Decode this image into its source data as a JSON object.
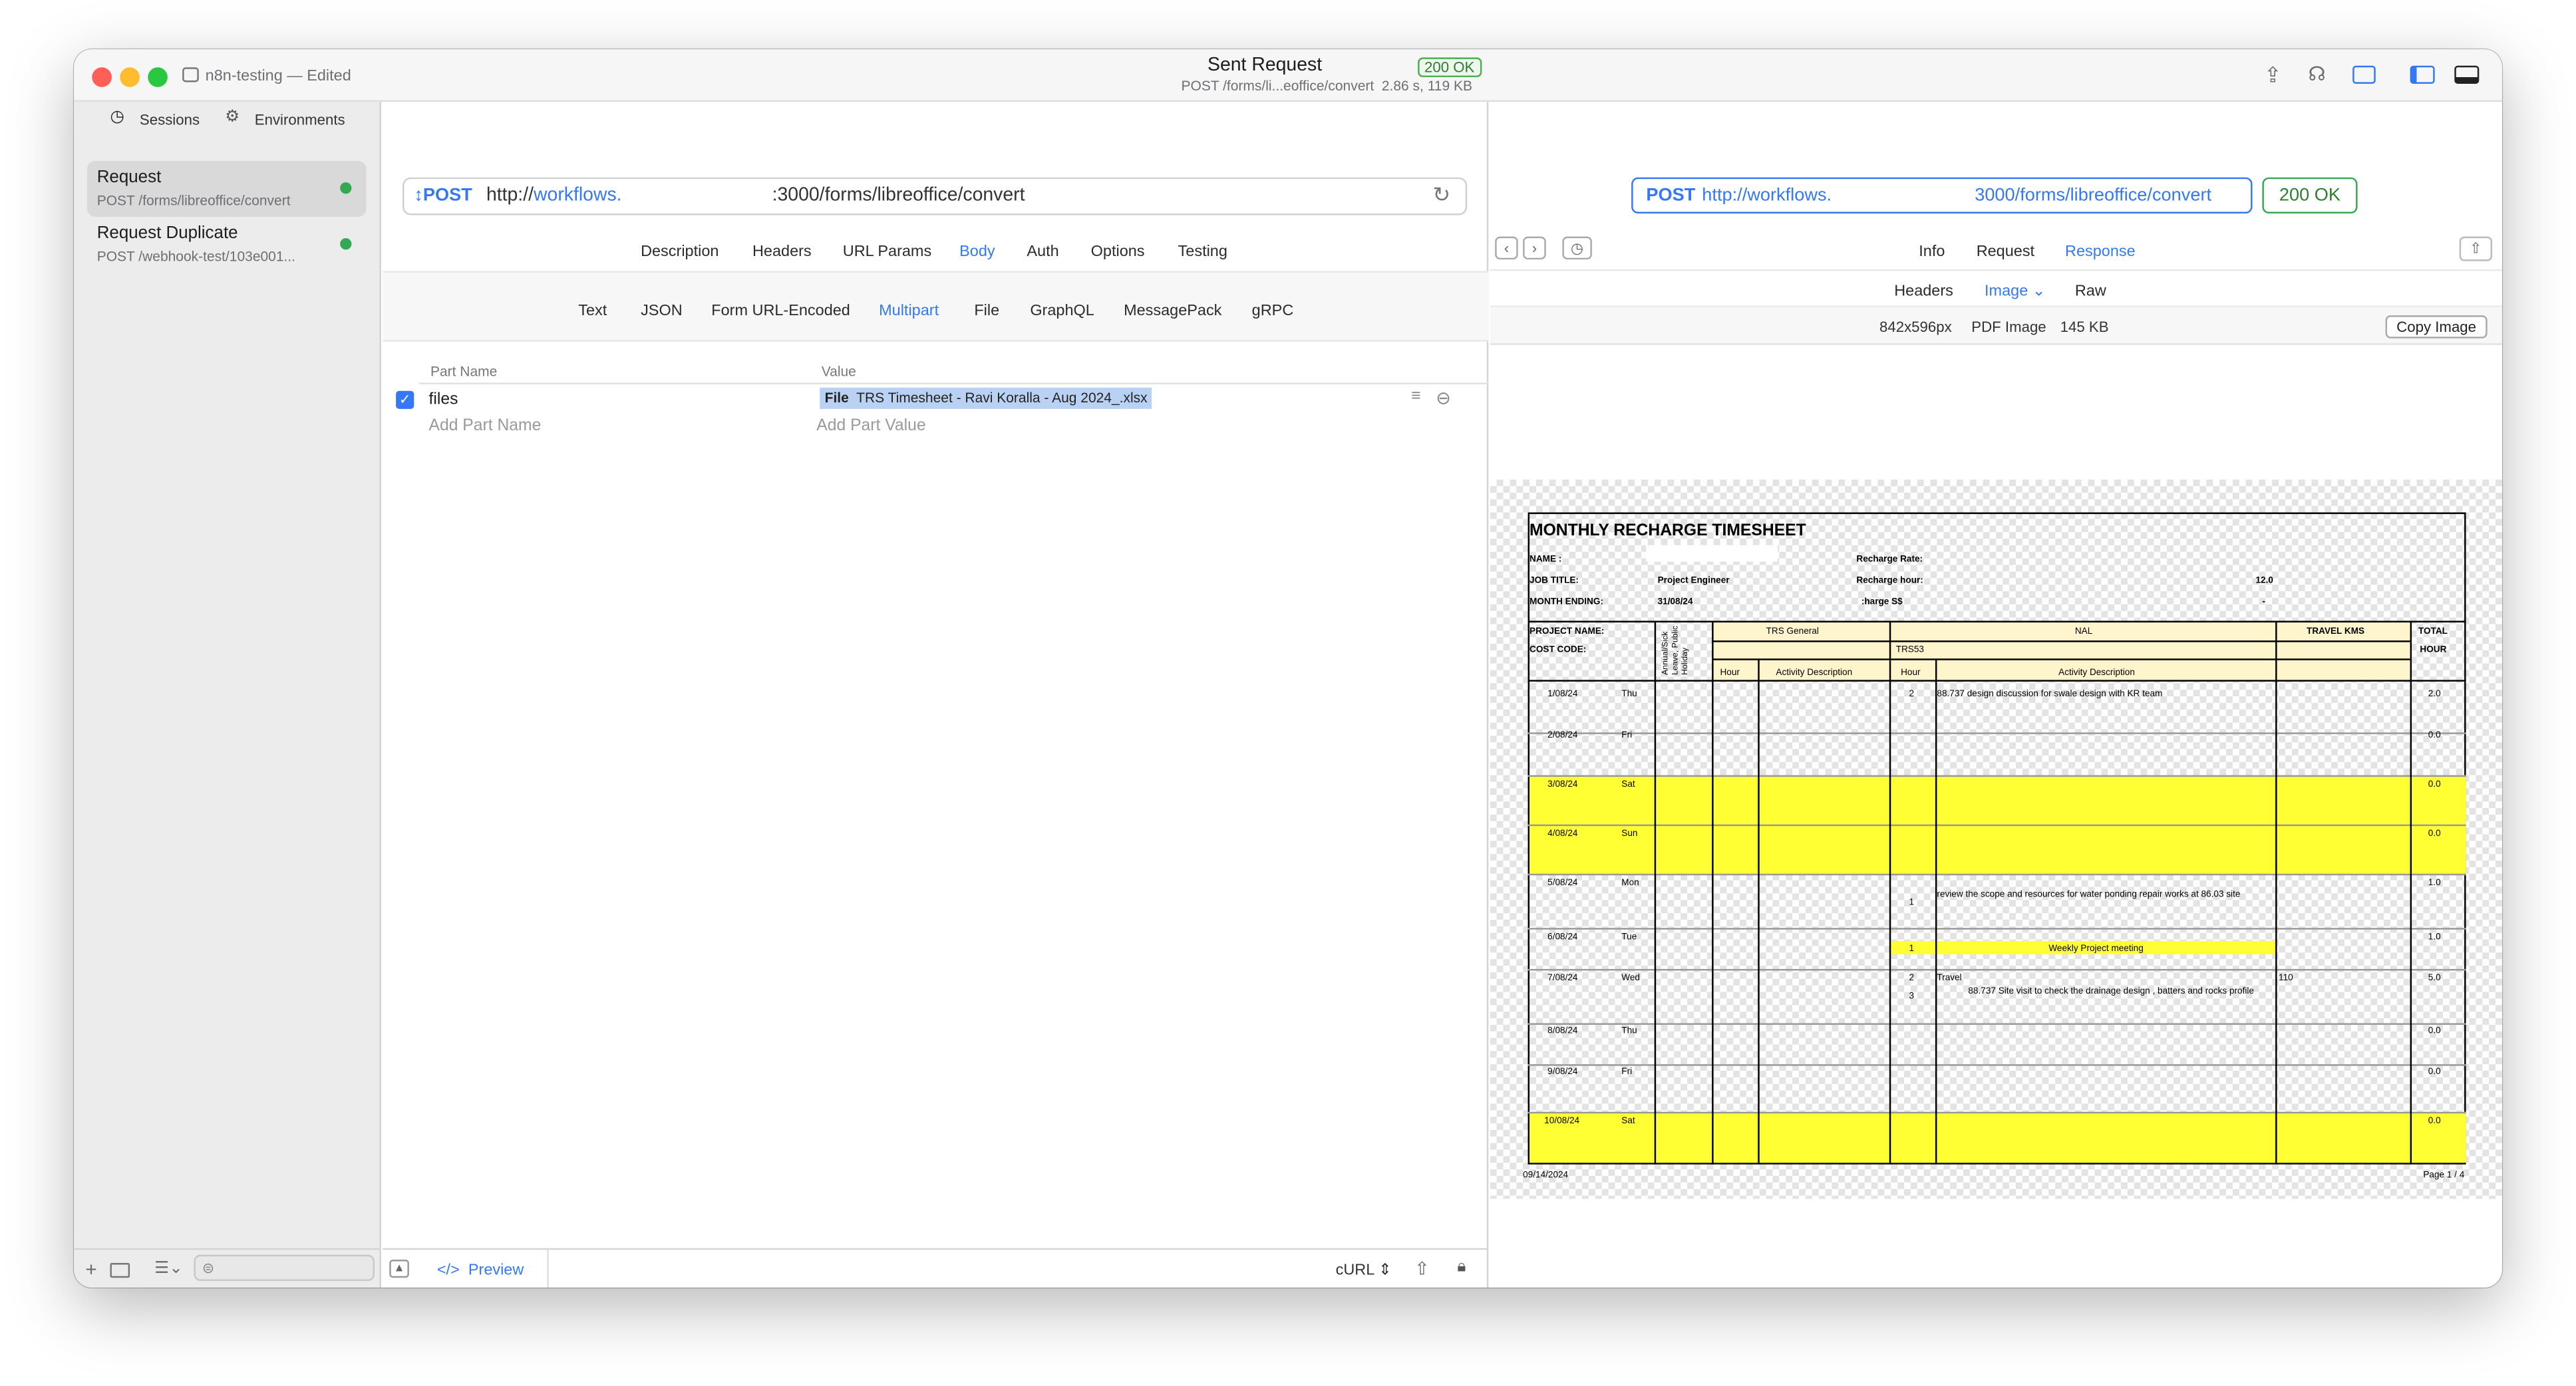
{
  "window": {
    "doc_title": "n8n-testing — Edited",
    "center_title": "Sent Request",
    "status_badge": "200 OK",
    "center_subtitle": "POST /forms/li...eoffice/convert  2.86 s, 119 KB"
  },
  "sidebar": {
    "tabs": [
      "Sessions",
      "Environments"
    ],
    "items": [
      {
        "name": "Request",
        "path": "POST /forms/libreoffice/convert",
        "status_color": "#34a853"
      },
      {
        "name": "Request Duplicate",
        "path": "POST /webhook-test/103e001...",
        "status_color": "#34a853"
      }
    ]
  },
  "request": {
    "method": "POST",
    "url_prefix": "http://",
    "url_host": "workflows.",
    "url_rest": ":3000/forms/libreoffice/convert",
    "tabs": [
      "Description",
      "Headers",
      "URL Params",
      "Body",
      "Auth",
      "Options",
      "Testing"
    ],
    "active_tab": "Body",
    "body_types": [
      "Text",
      "JSON",
      "Form URL-Encoded",
      "Multipart",
      "File",
      "GraphQL",
      "MessagePack",
      "gRPC"
    ],
    "active_body_type": "Multipart",
    "table": {
      "headers": [
        "Part Name",
        "Value"
      ],
      "rows": [
        {
          "name": "files",
          "type": "File",
          "value": "TRS Timesheet - Ravi Koralla - Aug 2024_.xlsx",
          "checked": true
        }
      ],
      "add_name_placeholder": "Add Part Name",
      "add_value_placeholder": "Add Part Value"
    },
    "bottom": {
      "preview": "Preview",
      "format": "cURL"
    }
  },
  "response": {
    "method": "POST",
    "url_prefix": "http://",
    "url_host": "workflows.",
    "url_rest": "3000/forms/libreoffice/convert",
    "status": "200 OK",
    "tabs": [
      "Info",
      "Request",
      "Response"
    ],
    "active_tab": "Response",
    "subtabs": [
      "Headers",
      "Image",
      "Raw"
    ],
    "active_subtab": "Image",
    "image_info": {
      "dimensions": "842x596px",
      "type": "PDF Image",
      "size": "145 KB"
    },
    "copy_button": "Copy Image"
  },
  "timesheet": {
    "title": "MONTHLY RECHARGE TIMESHEET",
    "name_label": "NAME :",
    "job_title_label": "JOB TITLE:",
    "job_title": "Project Engineer",
    "month_ending_label": "MONTH ENDING:",
    "month_ending": "31/08/24",
    "recharge_rate_label": "Recharge Rate:",
    "recharge_hour_label": "Recharge hour:",
    "recharge_hour_value": "12.0",
    "charge_label": ":harge S$",
    "charge_value": "-",
    "project_name_label": "PROJECT NAME:",
    "cost_code_label": "COST CODE:",
    "leave_label": "Annual/Sick Leave, Public Holiday",
    "trs_general": "TRS General",
    "nal": "NAL",
    "travel_kms": "TRAVEL KMS",
    "total": "TOTAL",
    "hour": "HOUR",
    "cost_code": "TRS53",
    "col_hour": "Hour",
    "col_activity": "Activity Description",
    "rows": [
      {
        "date": "1/08/24",
        "day": "Thu",
        "hours": [
          "2"
        ],
        "activities": [
          "88.737 design discussion for swale design with KR team"
        ],
        "kms": "",
        "total": "2.0"
      },
      {
        "date": "2/08/24",
        "day": "Fri",
        "hours": [],
        "activities": [],
        "kms": "",
        "total": "0.0"
      },
      {
        "date": "3/08/24",
        "day": "Sat",
        "hours": [],
        "activities": [],
        "kms": "",
        "total": "0.0"
      },
      {
        "date": "4/08/24",
        "day": "Sun",
        "hours": [],
        "activities": [],
        "kms": "",
        "total": "0.0"
      },
      {
        "date": "5/08/24",
        "day": "Mon",
        "hours": [
          "1"
        ],
        "activities": [
          "review the scope and resources for water ponding repair works at 86.03 site"
        ],
        "kms": "",
        "total": "1.0"
      },
      {
        "date": "6/08/24",
        "day": "Tue",
        "hours": [
          "1"
        ],
        "activities": [
          "Weekly Project meeting"
        ],
        "kms": "",
        "total": "1.0"
      },
      {
        "date": "7/08/24",
        "day": "Wed",
        "hours": [
          "2",
          "3"
        ],
        "activities": [
          "Travel",
          "88.737 Site visit to check the drainage design , batters and rocks profile"
        ],
        "kms": "110",
        "total": "5.0"
      },
      {
        "date": "8/08/24",
        "day": "Thu",
        "hours": [],
        "activities": [],
        "kms": "",
        "total": "0.0"
      },
      {
        "date": "9/08/24",
        "day": "Fri",
        "hours": [],
        "activities": [],
        "kms": "",
        "total": "0.0"
      },
      {
        "date": "10/08/24",
        "day": "Sat",
        "hours": [],
        "activities": [],
        "kms": "",
        "total": "0.0"
      }
    ],
    "footer_date": "09/14/2024",
    "footer_page": "Page 1 / 4"
  }
}
